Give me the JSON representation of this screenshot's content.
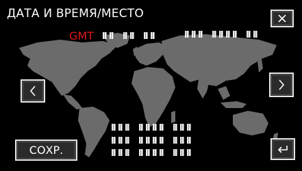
{
  "screen": {
    "title": "ДАТА И ВРЕМЯ/МЕСТО",
    "timezone_label": "GMT",
    "timezone_color": "#e01818",
    "accent_text_color": "#ffffff",
    "map_land_color": "#6b6b6b"
  },
  "buttons": {
    "close_icon": "close-icon",
    "prev_icon": "chevron-left-icon",
    "next_icon": "chevron-right-icon",
    "save_label": "СОХР.",
    "back_icon": "return-icon"
  }
}
